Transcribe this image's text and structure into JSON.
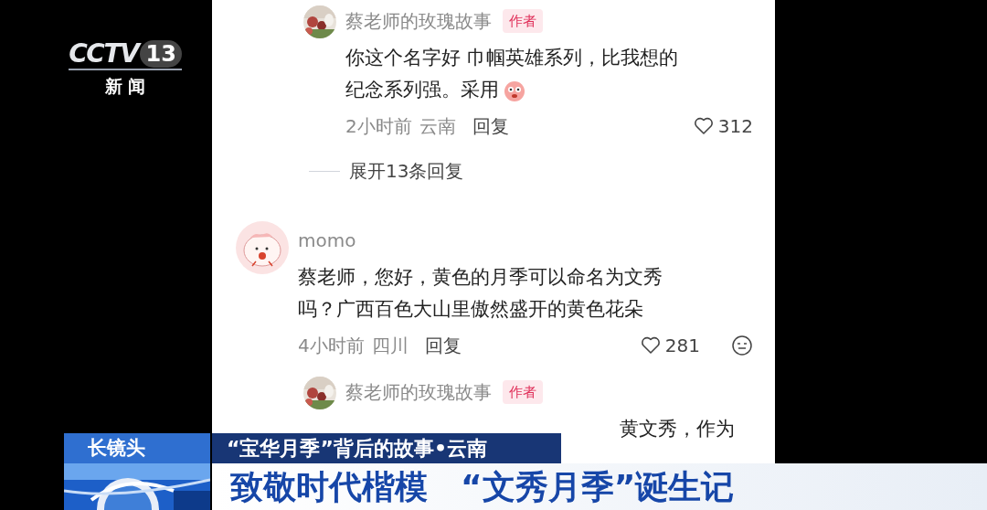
{
  "channel_logo": {
    "mark": "CCTV",
    "number": "13",
    "name": "新 闻"
  },
  "comments": [
    {
      "kind": "reply",
      "user": "蔡老师的玫瑰故事",
      "badge": "作者",
      "lines": [
        "你这个名字好 巾帼英雄系列，比我想的",
        "纪念系列强。采用"
      ],
      "emoji": true,
      "time": "2小时前",
      "location": "云南",
      "reply": "回复",
      "likes": "312",
      "more_menu": false
    },
    {
      "kind": "expand",
      "label": "展开13条回复"
    },
    {
      "kind": "comment",
      "user": "momo",
      "lines": [
        "蔡老师，您好，黄色的月季可以命名为文秀",
        "吗？广西百色大山里傲然盛开的黄色花朵"
      ],
      "emoji": false,
      "time": "4小时前",
      "location": "四川",
      "reply": "回复",
      "likes": "281",
      "more_menu": true
    },
    {
      "kind": "reply",
      "user": "蔡老师的玫瑰故事",
      "badge": "作者",
      "lines": [
        "黄文秀，作为"
      ],
      "cut": true
    }
  ],
  "lower_third": {
    "program": "长镜头",
    "subtitle": "“宝华月季”背后的故事•云南",
    "headline": "致敬时代楷模　“文秀月季”诞生记"
  }
}
